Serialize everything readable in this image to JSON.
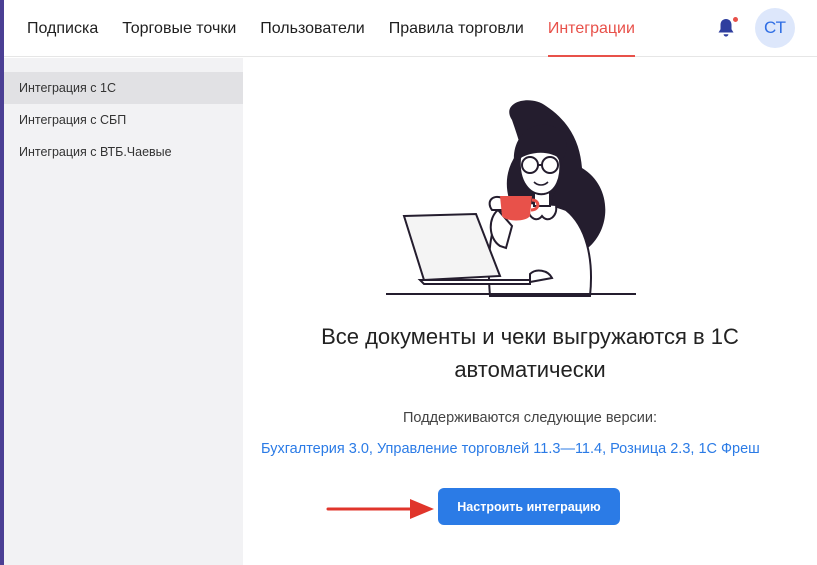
{
  "nav": {
    "tabs": [
      {
        "label": "Подписка"
      },
      {
        "label": "Торговые точки"
      },
      {
        "label": "Пользователи"
      },
      {
        "label": "Правила торговли"
      },
      {
        "label": "Интеграции",
        "active": true
      }
    ]
  },
  "user": {
    "initials": "СТ",
    "has_notifications": true
  },
  "sidebar": {
    "items": [
      {
        "label": "Интеграция с 1С",
        "active": true
      },
      {
        "label": "Интеграция с СБП"
      },
      {
        "label": "Интеграция с ВТБ.Чаевые"
      }
    ]
  },
  "main": {
    "headline_line1": "Все документы и чеки выгружаются в 1С",
    "headline_line2": "автоматически",
    "versions_label": "Поддерживаются следующие версии:",
    "versions_list": "Бухгалтерия 3.0, Управление торговлей 11.3—11.4, Розница 2.3, 1С Фреш",
    "setup_button": "Настроить интеграцию"
  },
  "colors": {
    "accent_active": "#e8514a",
    "primary_blue": "#2b7be6",
    "left_accent": "#4b3f94",
    "sidebar_bg": "#f2f2f4"
  },
  "icons": [
    "bell-icon",
    "red-arrow-annotation",
    "woman-with-coffee-illustration"
  ]
}
